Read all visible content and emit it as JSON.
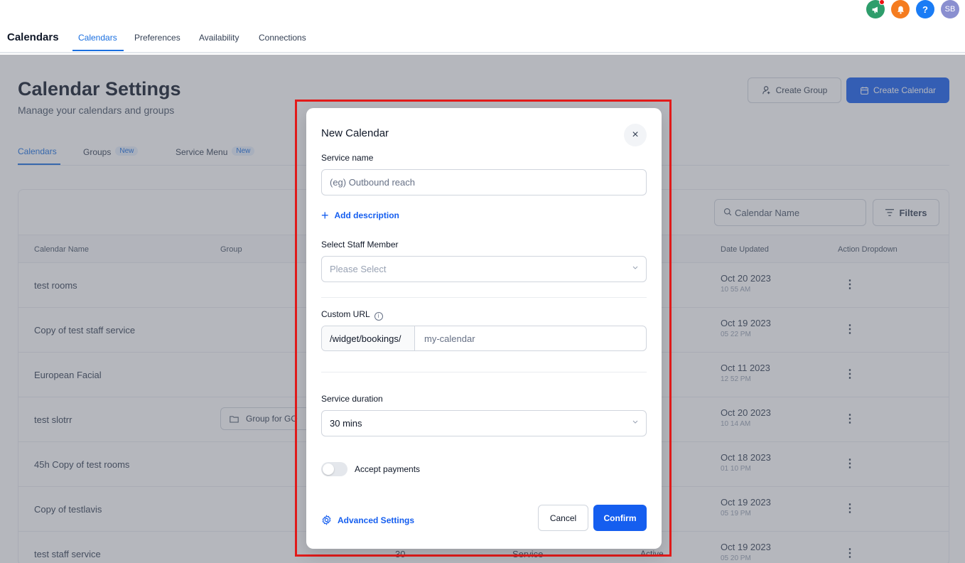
{
  "header": {
    "avatar_initials": "SB",
    "help_glyph": "?",
    "icons": [
      "megaphone-icon",
      "bell-icon",
      "help-icon",
      "avatar"
    ]
  },
  "nav": {
    "title": "Calendars",
    "tabs": [
      "Calendars",
      "Preferences",
      "Availability",
      "Connections"
    ]
  },
  "page": {
    "title": "Calendar Settings",
    "subtitle": "Manage your calendars and groups",
    "create_group_label": "Create Group",
    "create_calendar_label": "Create Calendar",
    "sub_tabs": [
      {
        "label": "Calendars",
        "badge": ""
      },
      {
        "label": "Groups",
        "badge": "New"
      },
      {
        "label": "Service Menu",
        "badge": "New"
      }
    ],
    "search_placeholder": "Calendar Name",
    "filters_label": "Filters"
  },
  "table": {
    "columns": {
      "name": "Calendar Name",
      "group": "Group",
      "date": "Date Updated",
      "action": "Action Dropdown"
    },
    "rows": [
      {
        "name": "test rooms",
        "date": "Oct 20 2023",
        "time": "10 55 AM",
        "group": ""
      },
      {
        "name": "Copy of test staff service",
        "date": "Oct 19 2023",
        "time": "05 22 PM",
        "group": ""
      },
      {
        "name": "European Facial",
        "date": "Oct 11 2023",
        "time": "12 52 PM",
        "group": ""
      },
      {
        "name": "test slotrr",
        "date": "Oct 20 2023",
        "time": "10 14 AM",
        "group": "Group for GO"
      },
      {
        "name": "45h Copy of test rooms",
        "date": "Oct 18 2023",
        "time": "01 10 PM",
        "group": ""
      },
      {
        "name": "Copy of testlavis",
        "date": "Oct 19 2023",
        "time": "05 19 PM",
        "group": ""
      },
      {
        "name": "test staff service",
        "date": "Oct 19 2023",
        "time": "05 20 PM",
        "group": "",
        "duration": "30",
        "type": "Service",
        "status": "Active"
      }
    ]
  },
  "modal": {
    "title": "New Calendar",
    "close_glyph": "×",
    "service_name_label": "Service name",
    "service_name_placeholder": "(eg) Outbound reach",
    "add_description_label": "Add description",
    "staff_label": "Select Staff Member",
    "staff_placeholder": "Please Select",
    "custom_url_label": "Custom URL",
    "url_prefix": "/widget/bookings/",
    "url_slug": "my-calendar",
    "duration_label": "Service duration",
    "duration_value": "30 mins",
    "accept_payments_label": "Accept payments",
    "accept_payments_on": false,
    "advanced_settings_label": "Advanced Settings",
    "cancel_label": "Cancel",
    "confirm_label": "Confirm"
  },
  "colors": {
    "accent": "#155eef",
    "highlight_border": "#e31b1b"
  }
}
